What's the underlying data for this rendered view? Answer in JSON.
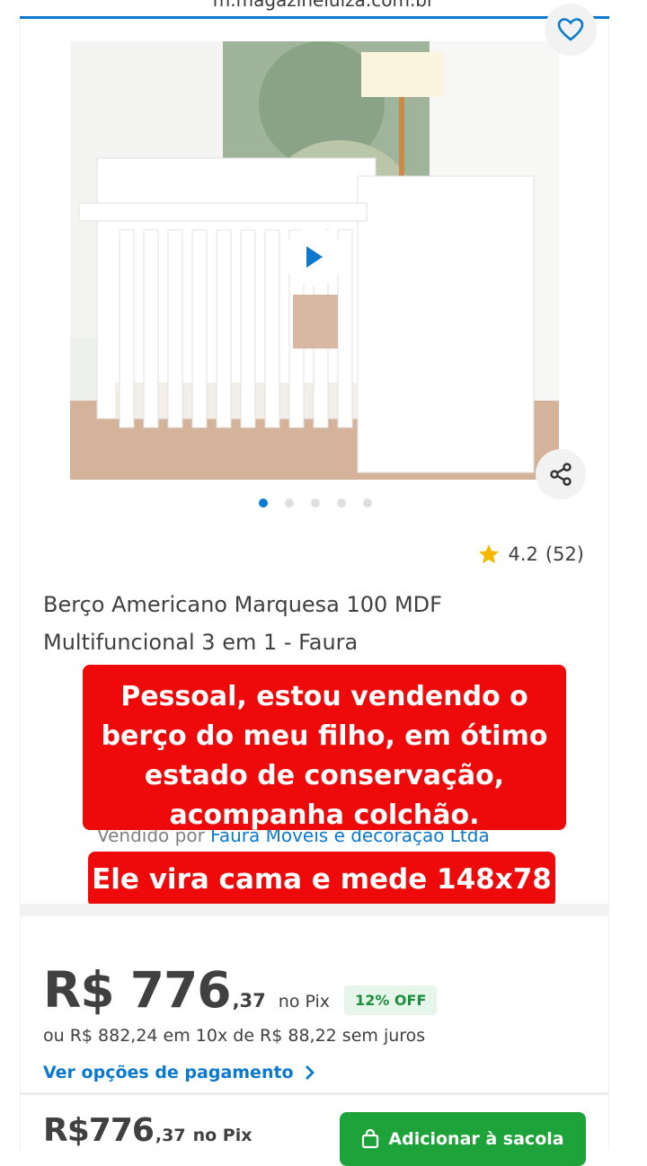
{
  "browser": {
    "url": "m.magazineluiza.com.br"
  },
  "gallery": {
    "total_images": 5,
    "active_index": 0
  },
  "rating": {
    "value": "4.2",
    "count": "(52)"
  },
  "product": {
    "title": "Berço Americano Marquesa 100 MDF Multifuncional 3 em 1 - Faura"
  },
  "seller": {
    "prefix": "Vendido por",
    "name": "Faura Móveis e decoração Ltda"
  },
  "overlay": {
    "text1": "Pessoal, estou vendendo o\nberço do meu filho, em ótimo\nestado de conservação,\nacompanha colchão.",
    "text2": "Ele vira cama e mede 148x78"
  },
  "price": {
    "main": "R$ 776",
    "cents": ",37",
    "pix_label": "no Pix",
    "discount": "12% OFF",
    "installments": "ou R$ 882,24 em 10x de R$ 88,22 sem juros",
    "payment_options_link": "Ver opções de pagamento"
  },
  "bottom_bar": {
    "price_main": "R$776",
    "price_cents": ",37",
    "pix_label": "no Pix",
    "add_button": "Adicionar à sacola"
  },
  "colors": {
    "brand_blue": "#0b79d0",
    "overlay_red": "#ee0a0a",
    "buy_green": "#1ea33a",
    "star": "#f5b800"
  },
  "icons": {
    "favorite": "heart-outline-icon",
    "play": "play-icon",
    "share": "share-icon",
    "rating": "star-icon",
    "chevron": "chevron-right-icon",
    "bag": "shopping-bag-icon"
  }
}
